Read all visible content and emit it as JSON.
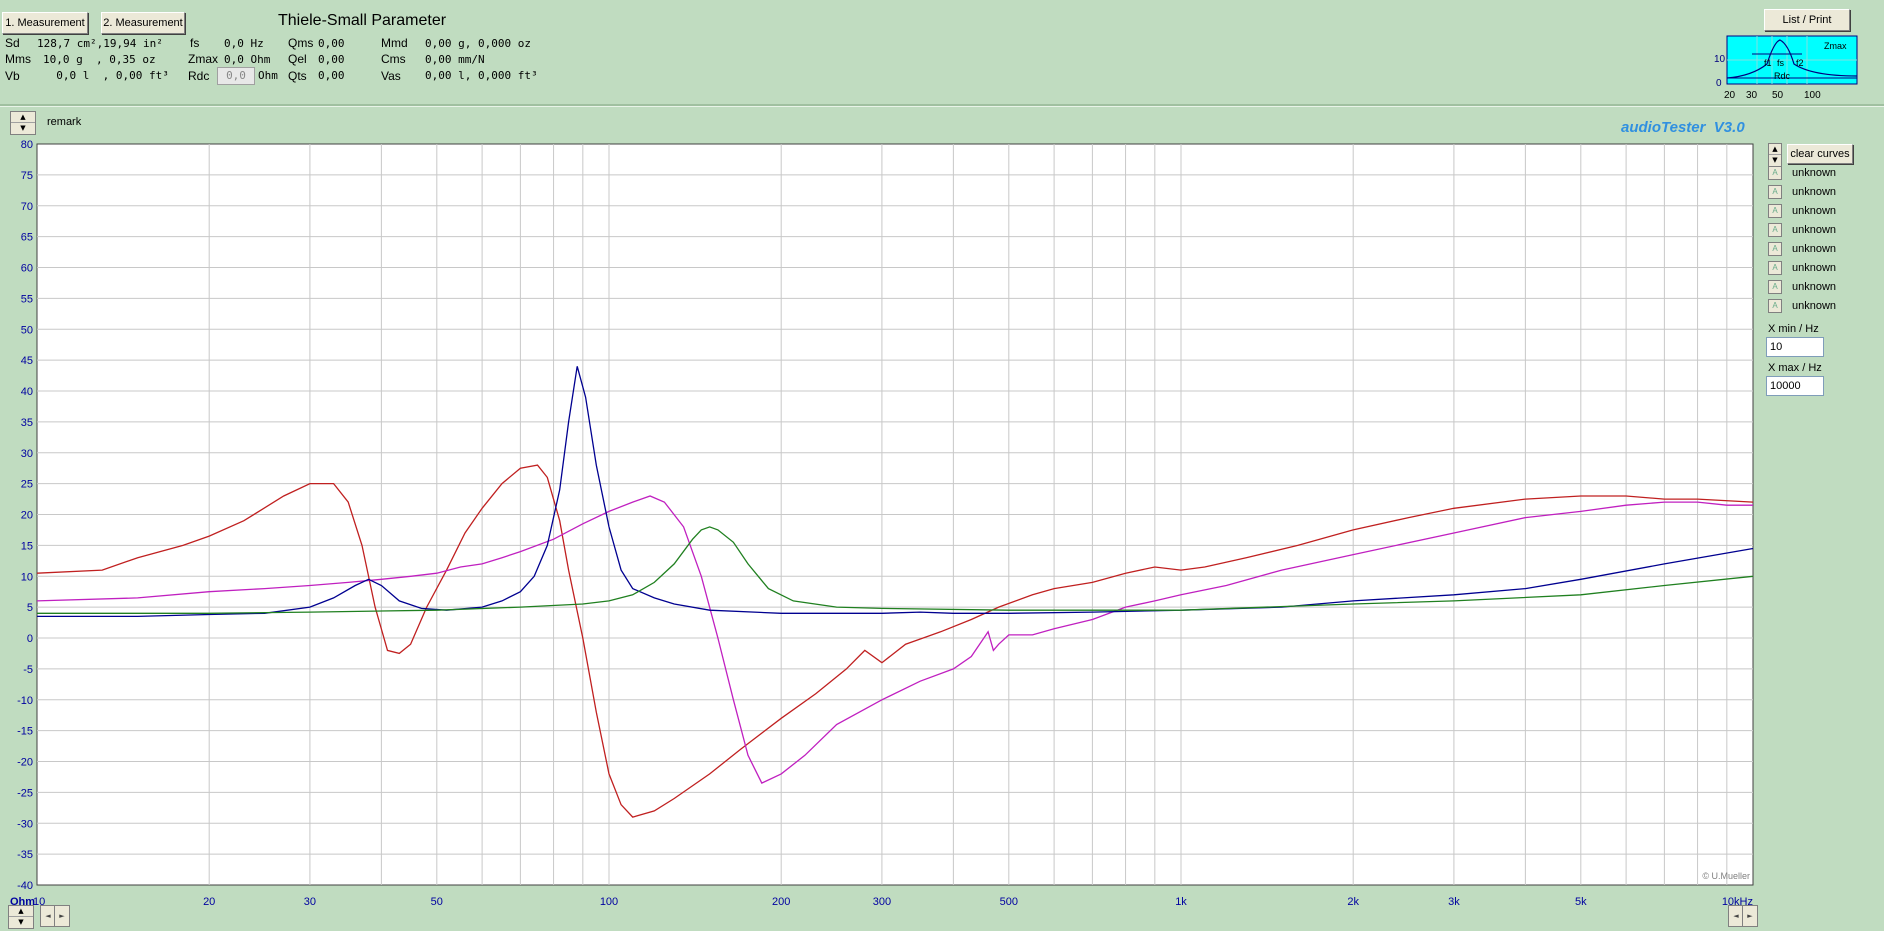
{
  "toolbar": {
    "measurement1_label": "1. Measurement",
    "measurement2_label": "2. Measurement",
    "list_print_label": "List / Print"
  },
  "thiele_small": {
    "title": "Thiele-Small Parameter",
    "col1": [
      {
        "label": "Sd",
        "value": "128,7 cm²,19,94 in²"
      },
      {
        "label": "Mms",
        "value": "10,0 g  , 0,35 oz"
      },
      {
        "label": "Vb",
        "value": "  0,0 l  , 0,00 ft³"
      }
    ],
    "col2": [
      {
        "label": "fs",
        "value": "0,0 Hz"
      },
      {
        "label": "Zmax",
        "value": "0,0 Ohm"
      },
      {
        "label": "Rdc",
        "input": "0,0",
        "unit": "Ohm"
      }
    ],
    "col3": [
      {
        "label": "Qms",
        "value": "0,00"
      },
      {
        "label": "Qel",
        "value": "0,00"
      },
      {
        "label": "Qts",
        "value": "0,00"
      }
    ],
    "col4": [
      {
        "label": "Mmd",
        "value": "0,00 g, 0,000 oz"
      },
      {
        "label": "Cms",
        "value": "0,00 mm/N"
      },
      {
        "label": "Vas",
        "value": "0,00 l, 0,000 ft³"
      }
    ]
  },
  "thumbnail": {
    "y_ticks": [
      "10",
      "0"
    ],
    "x_ticks": [
      "20",
      "30",
      "50",
      "100"
    ],
    "labels": [
      "f1",
      "fs",
      "f2",
      "Rdc",
      "Zmax"
    ]
  },
  "remark_label": "remark",
  "app_brand": "audioTester  V3.0",
  "copyright": "© U.Mueller",
  "legend": {
    "clear_label": "clear curves",
    "items": [
      "unknown",
      "unknown",
      "unknown",
      "unknown",
      "unknown",
      "unknown",
      "unknown",
      "unknown"
    ],
    "box_letter": "A"
  },
  "range": {
    "xmin_label": "X min / Hz",
    "xmin_value": "10",
    "xmax_label": "X max / Hz",
    "xmax_value": "10000"
  },
  "colors": {
    "red": "#c02020",
    "blue": "#000090",
    "green": "#208020",
    "magenta": "#c020c0",
    "grid": "#c8c8c8",
    "axis_text": "#0000a0",
    "brand": "#3090e0"
  },
  "chart_data": {
    "type": "line",
    "xscale": "log",
    "xlim": [
      10,
      10000
    ],
    "ylim": [
      -40,
      80
    ],
    "y_ticks": [
      80,
      75,
      70,
      65,
      60,
      55,
      50,
      45,
      40,
      35,
      30,
      25,
      20,
      15,
      10,
      5,
      0,
      -5,
      -10,
      -15,
      -20,
      -25,
      -30,
      -35,
      -40
    ],
    "x_tick_values": [
      10,
      20,
      30,
      50,
      100,
      200,
      300,
      500,
      1000,
      2000,
      3000,
      5000,
      10000
    ],
    "x_tick_labels": [
      "10",
      "20",
      "30",
      "50",
      "100",
      "200",
      "300",
      "500",
      "1k",
      "2k",
      "3k",
      "5k",
      "10kHz"
    ],
    "y_unit_label": "Ohm",
    "grid": true,
    "series": [
      {
        "color": "red",
        "points": [
          [
            10,
            10.5
          ],
          [
            13,
            11
          ],
          [
            15,
            13
          ],
          [
            18,
            15
          ],
          [
            20,
            16.5
          ],
          [
            23,
            19
          ],
          [
            27,
            23
          ],
          [
            30,
            25
          ],
          [
            33,
            25
          ],
          [
            35,
            22
          ],
          [
            37,
            15
          ],
          [
            39,
            5
          ],
          [
            41,
            -2
          ],
          [
            43,
            -2.5
          ],
          [
            45,
            -1
          ],
          [
            48,
            5
          ],
          [
            52,
            11
          ],
          [
            56,
            17
          ],
          [
            60,
            21
          ],
          [
            65,
            25
          ],
          [
            70,
            27.5
          ],
          [
            75,
            28
          ],
          [
            78,
            26
          ],
          [
            82,
            19
          ],
          [
            85,
            11
          ],
          [
            90,
            0
          ],
          [
            95,
            -12
          ],
          [
            100,
            -22
          ],
          [
            105,
            -27
          ],
          [
            110,
            -29
          ],
          [
            120,
            -28
          ],
          [
            130,
            -26
          ],
          [
            150,
            -22
          ],
          [
            170,
            -18
          ],
          [
            200,
            -13
          ],
          [
            230,
            -9
          ],
          [
            260,
            -5
          ],
          [
            280,
            -2
          ],
          [
            300,
            -4
          ],
          [
            330,
            -1
          ],
          [
            380,
            1
          ],
          [
            430,
            3
          ],
          [
            480,
            5
          ],
          [
            550,
            7
          ],
          [
            600,
            8
          ],
          [
            700,
            9
          ],
          [
            800,
            10.5
          ],
          [
            900,
            11.5
          ],
          [
            1000,
            11
          ],
          [
            1100,
            11.5
          ],
          [
            1300,
            13
          ],
          [
            1600,
            15
          ],
          [
            2000,
            17.5
          ],
          [
            2500,
            19.5
          ],
          [
            3000,
            21
          ],
          [
            4000,
            22.5
          ],
          [
            5000,
            23
          ],
          [
            6000,
            23
          ],
          [
            7000,
            22.5
          ],
          [
            8000,
            22.5
          ],
          [
            10000,
            22
          ]
        ]
      },
      {
        "color": "magenta",
        "points": [
          [
            10,
            6
          ],
          [
            15,
            6.5
          ],
          [
            20,
            7.5
          ],
          [
            25,
            8
          ],
          [
            30,
            8.5
          ],
          [
            35,
            9
          ],
          [
            40,
            9.5
          ],
          [
            45,
            10
          ],
          [
            50,
            10.5
          ],
          [
            55,
            11.5
          ],
          [
            60,
            12
          ],
          [
            65,
            13
          ],
          [
            70,
            14
          ],
          [
            80,
            16
          ],
          [
            90,
            18.5
          ],
          [
            100,
            20.5
          ],
          [
            110,
            22
          ],
          [
            118,
            23
          ],
          [
            125,
            22
          ],
          [
            135,
            18
          ],
          [
            145,
            10
          ],
          [
            155,
            0
          ],
          [
            165,
            -10
          ],
          [
            175,
            -19
          ],
          [
            185,
            -23.5
          ],
          [
            200,
            -22
          ],
          [
            220,
            -19
          ],
          [
            250,
            -14
          ],
          [
            300,
            -10
          ],
          [
            350,
            -7
          ],
          [
            400,
            -5
          ],
          [
            430,
            -3
          ],
          [
            460,
            1
          ],
          [
            470,
            -2
          ],
          [
            480,
            -1
          ],
          [
            500,
            0.5
          ],
          [
            550,
            0.5
          ],
          [
            600,
            1.5
          ],
          [
            700,
            3
          ],
          [
            800,
            5
          ],
          [
            900,
            6
          ],
          [
            1000,
            7
          ],
          [
            1200,
            8.5
          ],
          [
            1500,
            11
          ],
          [
            2000,
            13.5
          ],
          [
            3000,
            17
          ],
          [
            4000,
            19.5
          ],
          [
            5000,
            20.5
          ],
          [
            6000,
            21.5
          ],
          [
            7000,
            22
          ],
          [
            8000,
            22
          ],
          [
            9000,
            21.5
          ],
          [
            10000,
            21.5
          ]
        ]
      },
      {
        "color": "blue",
        "points": [
          [
            10,
            3.5
          ],
          [
            15,
            3.5
          ],
          [
            20,
            3.8
          ],
          [
            25,
            4
          ],
          [
            30,
            5
          ],
          [
            33,
            6.5
          ],
          [
            36,
            8.5
          ],
          [
            38,
            9.5
          ],
          [
            40,
            8.5
          ],
          [
            43,
            6
          ],
          [
            47,
            4.8
          ],
          [
            52,
            4.5
          ],
          [
            60,
            5
          ],
          [
            65,
            6
          ],
          [
            70,
            7.5
          ],
          [
            74,
            10
          ],
          [
            78,
            15
          ],
          [
            82,
            24
          ],
          [
            85,
            35
          ],
          [
            88,
            44
          ],
          [
            91,
            39
          ],
          [
            95,
            28
          ],
          [
            100,
            18
          ],
          [
            105,
            11
          ],
          [
            110,
            8
          ],
          [
            120,
            6.5
          ],
          [
            130,
            5.5
          ],
          [
            150,
            4.5
          ],
          [
            200,
            4
          ],
          [
            250,
            4
          ],
          [
            300,
            4
          ],
          [
            350,
            4.2
          ],
          [
            400,
            4
          ],
          [
            500,
            4
          ],
          [
            700,
            4.2
          ],
          [
            1000,
            4.5
          ],
          [
            1500,
            5
          ],
          [
            2000,
            6
          ],
          [
            3000,
            7
          ],
          [
            4000,
            8
          ],
          [
            5000,
            9.5
          ],
          [
            7000,
            12
          ],
          [
            10000,
            14.5
          ]
        ]
      },
      {
        "color": "green",
        "points": [
          [
            10,
            4
          ],
          [
            20,
            4
          ],
          [
            30,
            4.2
          ],
          [
            50,
            4.5
          ],
          [
            70,
            5
          ],
          [
            90,
            5.5
          ],
          [
            100,
            6
          ],
          [
            110,
            7
          ],
          [
            120,
            9
          ],
          [
            130,
            12
          ],
          [
            140,
            16
          ],
          [
            145,
            17.5
          ],
          [
            150,
            18
          ],
          [
            155,
            17.5
          ],
          [
            165,
            15.5
          ],
          [
            175,
            12
          ],
          [
            190,
            8
          ],
          [
            210,
            6
          ],
          [
            250,
            5
          ],
          [
            300,
            4.8
          ],
          [
            500,
            4.5
          ],
          [
            1000,
            4.5
          ],
          [
            2000,
            5.5
          ],
          [
            3000,
            6
          ],
          [
            5000,
            7
          ],
          [
            7000,
            8.5
          ],
          [
            10000,
            10
          ]
        ]
      }
    ]
  }
}
